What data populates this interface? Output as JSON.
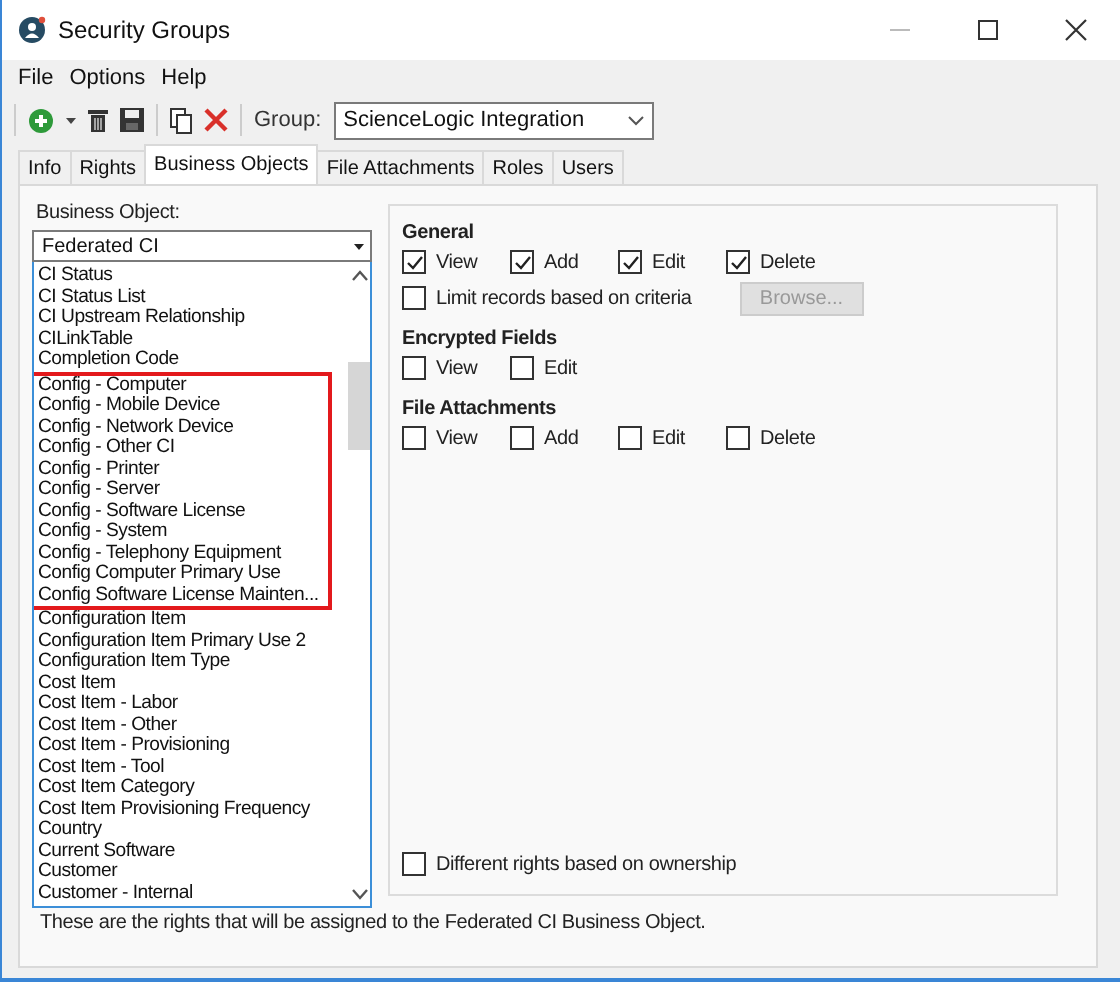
{
  "window": {
    "title": "Security Groups"
  },
  "menu": [
    {
      "label": "File"
    },
    {
      "label": "Options"
    },
    {
      "label": "Help"
    }
  ],
  "toolbar": {
    "group_label": "Group:",
    "group_value": "ScienceLogic Integration"
  },
  "tabs": [
    {
      "label": "Info",
      "selected": false
    },
    {
      "label": "Rights",
      "selected": false
    },
    {
      "label": "Business Objects",
      "selected": true
    },
    {
      "label": "File Attachments",
      "selected": false
    },
    {
      "label": "Roles",
      "selected": false
    },
    {
      "label": "Users",
      "selected": false
    }
  ],
  "business_object": {
    "label": "Business Object:",
    "value": "Federated CI",
    "list_groups": [
      {
        "highlighted": false,
        "items": [
          "CI Status",
          "CI Status List",
          "CI Upstream Relationship",
          "CILinkTable",
          "Completion Code"
        ]
      },
      {
        "highlighted": true,
        "items": [
          "Config - Computer",
          "Config - Mobile Device",
          "Config - Network Device",
          "Config - Other CI",
          "Config - Printer",
          "Config - Server",
          "Config - Software License",
          "Config - System",
          "Config - Telephony Equipment",
          "Config Computer Primary Use",
          "Config  Software  License  Mainten..."
        ]
      },
      {
        "highlighted": false,
        "items": [
          "Configuration Item",
          "Configuration Item Primary Use 2",
          "Configuration Item Type",
          "Cost Item",
          "Cost Item - Labor",
          "Cost Item - Other",
          "Cost Item - Provisioning",
          "Cost Item - Tool",
          "Cost Item Category",
          "Cost Item Provisioning Frequency",
          "Country",
          "Current Software",
          "Customer",
          "Customer - Internal"
        ]
      }
    ]
  },
  "general": {
    "title": "General",
    "rights": [
      {
        "label": "View",
        "checked": true
      },
      {
        "label": "Add",
        "checked": true
      },
      {
        "label": "Edit",
        "checked": true
      },
      {
        "label": "Delete",
        "checked": true
      }
    ],
    "limit": {
      "label": "Limit records based on criteria",
      "checked": false
    },
    "browse": {
      "label": "Browse...",
      "disabled": true
    }
  },
  "encrypted_fields": {
    "title": "Encrypted Fields",
    "rights": [
      {
        "label": "View",
        "checked": false
      },
      {
        "label": "Edit",
        "checked": false
      }
    ]
  },
  "file_attachments": {
    "title": "File Attachments",
    "rights": [
      {
        "label": "View",
        "checked": false
      },
      {
        "label": "Add",
        "checked": false
      },
      {
        "label": "Edit",
        "checked": false
      },
      {
        "label": "Delete",
        "checked": false
      }
    ]
  },
  "ownership": {
    "label": "Different rights based on ownership",
    "checked": false
  },
  "footer": "These are the rights that will be assigned to the Federated CI Business Object."
}
